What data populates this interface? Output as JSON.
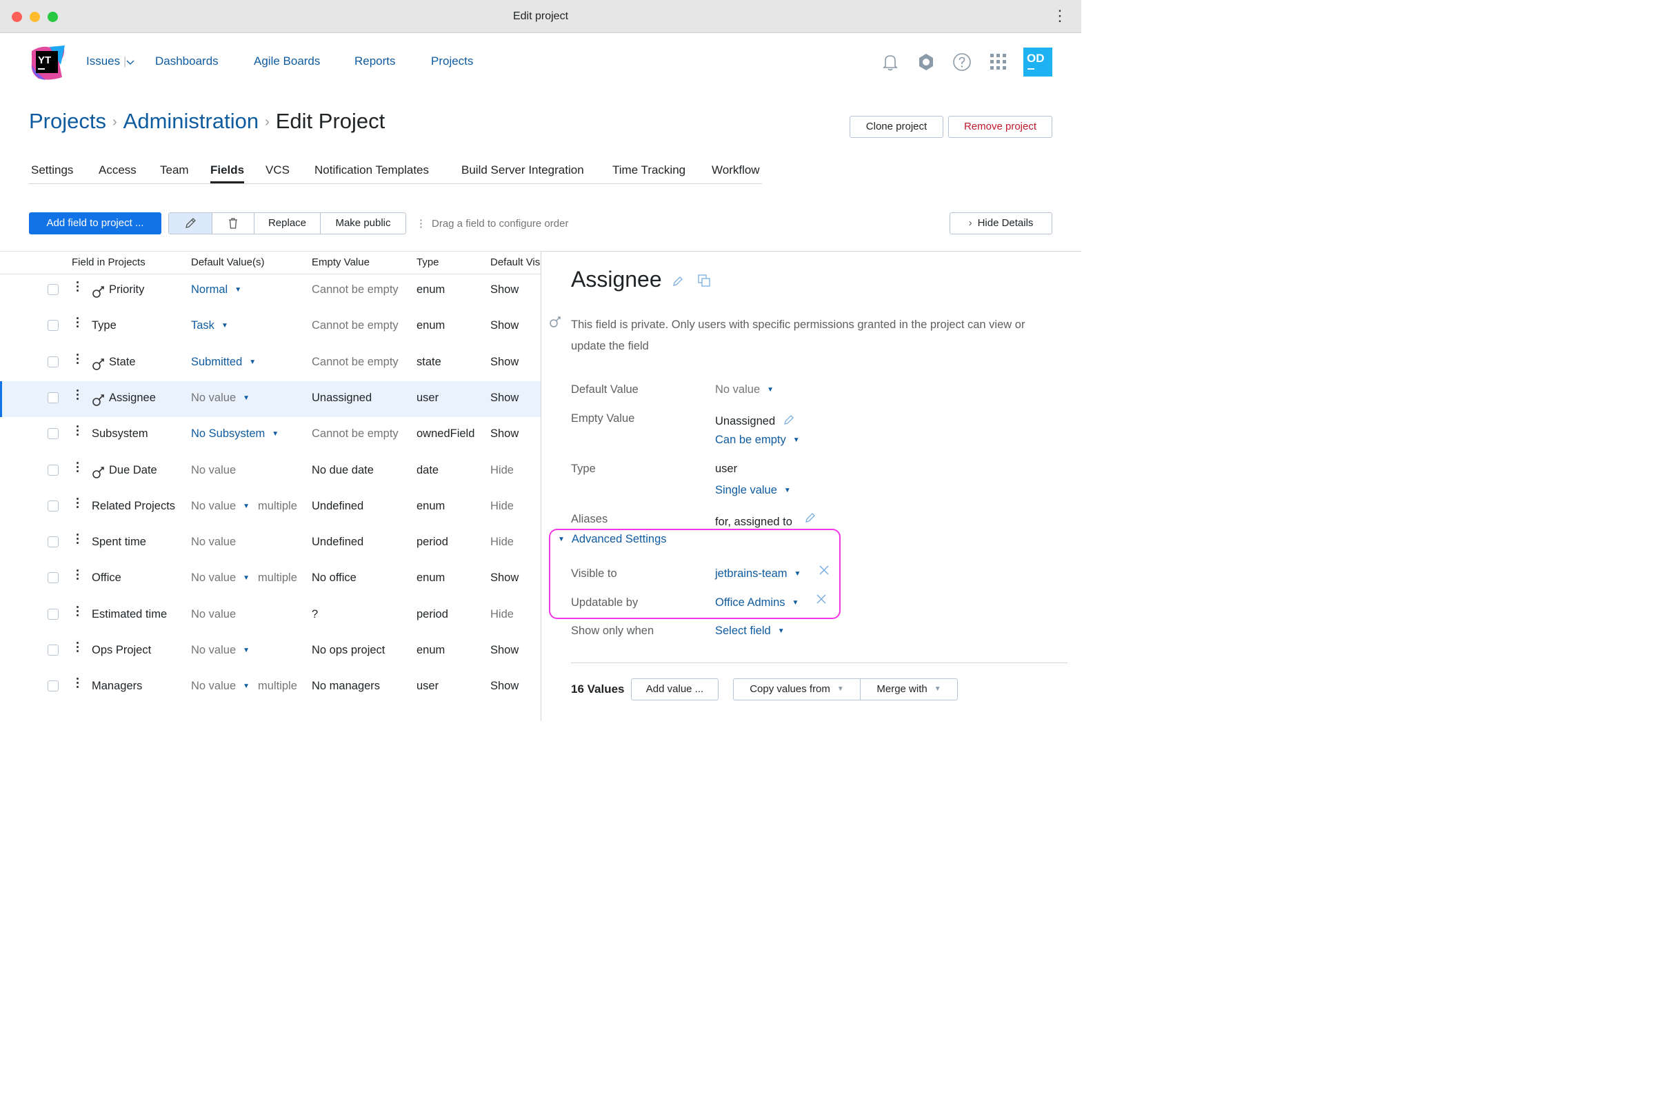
{
  "window": {
    "title": "Edit project"
  },
  "nav": {
    "items": [
      "Issues",
      "Dashboards",
      "Agile Boards",
      "Reports",
      "Projects"
    ]
  },
  "header": {
    "avatar_initials": "OD"
  },
  "breadcrumb": {
    "projects": "Projects",
    "administration": "Administration",
    "current": "Edit Project"
  },
  "actions": {
    "clone": "Clone project",
    "remove": "Remove project"
  },
  "tabs": [
    "Settings",
    "Access",
    "Team",
    "Fields",
    "VCS",
    "Notification Templates",
    "Build Server Integration",
    "Time Tracking",
    "Workflow"
  ],
  "active_tab": "Fields",
  "toolbar": {
    "add_field": "Add field to project ...",
    "replace": "Replace",
    "make_public": "Make public",
    "hint": "Drag a field to configure order",
    "hide_details": "Hide Details"
  },
  "table": {
    "columns": [
      "Field in Projects",
      "Default Value(s)",
      "Empty Value",
      "Type",
      "Default Vis"
    ],
    "rows": [
      {
        "name": "Priority",
        "private": true,
        "default": "Normal",
        "default_link": true,
        "caret": true,
        "multiple": "",
        "empty": "Cannot be empty",
        "empty_muted": true,
        "type": "enum",
        "vis": "Show"
      },
      {
        "name": "Type",
        "private": false,
        "default": "Task",
        "default_link": true,
        "caret": true,
        "multiple": "",
        "empty": "Cannot be empty",
        "empty_muted": true,
        "type": "enum",
        "vis": "Show"
      },
      {
        "name": "State",
        "private": true,
        "default": "Submitted",
        "default_link": true,
        "caret": true,
        "multiple": "",
        "empty": "Cannot be empty",
        "empty_muted": true,
        "type": "state",
        "vis": "Show"
      },
      {
        "name": "Assignee",
        "private": true,
        "default": "No value",
        "default_link": false,
        "caret": true,
        "multiple": "",
        "empty": "Unassigned",
        "empty_muted": false,
        "type": "user",
        "vis": "Show",
        "selected": true
      },
      {
        "name": "Subsystem",
        "private": false,
        "default": "No Subsystem",
        "default_link": true,
        "caret": true,
        "multiple": "",
        "empty": "Cannot be empty",
        "empty_muted": true,
        "type": "ownedField",
        "vis": "Show"
      },
      {
        "name": "Due Date",
        "private": true,
        "default": "No value",
        "default_link": false,
        "caret": false,
        "multiple": "",
        "empty": "No due date",
        "empty_muted": false,
        "type": "date",
        "vis": "Hide"
      },
      {
        "name": "Related Projects",
        "private": false,
        "default": "No value",
        "default_link": false,
        "caret": true,
        "multiple": "multiple",
        "empty": "Undefined",
        "empty_muted": false,
        "type": "enum",
        "vis": "Hide"
      },
      {
        "name": "Spent time",
        "private": false,
        "default": "No value",
        "default_link": false,
        "caret": false,
        "multiple": "",
        "empty": "Undefined",
        "empty_muted": false,
        "type": "period",
        "vis": "Hide"
      },
      {
        "name": "Office",
        "private": false,
        "default": "No value",
        "default_link": false,
        "caret": true,
        "multiple": "multiple",
        "empty": "No office",
        "empty_muted": false,
        "type": "enum",
        "vis": "Show"
      },
      {
        "name": "Estimated time",
        "private": false,
        "default": "No value",
        "default_link": false,
        "caret": false,
        "multiple": "",
        "empty": "?",
        "empty_muted": false,
        "type": "period",
        "vis": "Hide"
      },
      {
        "name": "Ops Project",
        "private": false,
        "default": "No value",
        "default_link": false,
        "caret": true,
        "multiple": "",
        "empty": "No ops project",
        "empty_muted": false,
        "type": "enum",
        "vis": "Show"
      },
      {
        "name": "Managers",
        "private": false,
        "default": "No value",
        "default_link": false,
        "caret": true,
        "multiple": "multiple",
        "empty": "No managers",
        "empty_muted": false,
        "type": "user",
        "vis": "Show"
      }
    ]
  },
  "details": {
    "title": "Assignee",
    "private_note_1": "This field is private. Only users with specific permissions granted in the project can view or",
    "private_note_2": "update the field",
    "default_value_label": "Default Value",
    "default_value": "No value",
    "empty_value_label": "Empty Value",
    "empty_value": "Unassigned",
    "empty_mode": "Can be empty",
    "type_label": "Type",
    "type_value": "user",
    "cardinality": "Single value",
    "aliases_label": "Aliases",
    "aliases": "for, assigned to",
    "advanced": "Advanced Settings",
    "visible_to_label": "Visible to",
    "visible_to": "jetbrains-team",
    "updatable_by_label": "Updatable by",
    "updatable_by": "Office Admins",
    "show_only_when_label": "Show only when",
    "show_only_when": "Select field",
    "values_count": "16 Values",
    "add_value": "Add value ...",
    "copy_values": "Copy values from",
    "merge_with": "Merge with"
  },
  "colors": {
    "link": "#0f5b9f",
    "primary": "#1273e6",
    "danger": "#c0192e",
    "highlight": "#f335e8",
    "avatar": "#1eb2f2"
  }
}
